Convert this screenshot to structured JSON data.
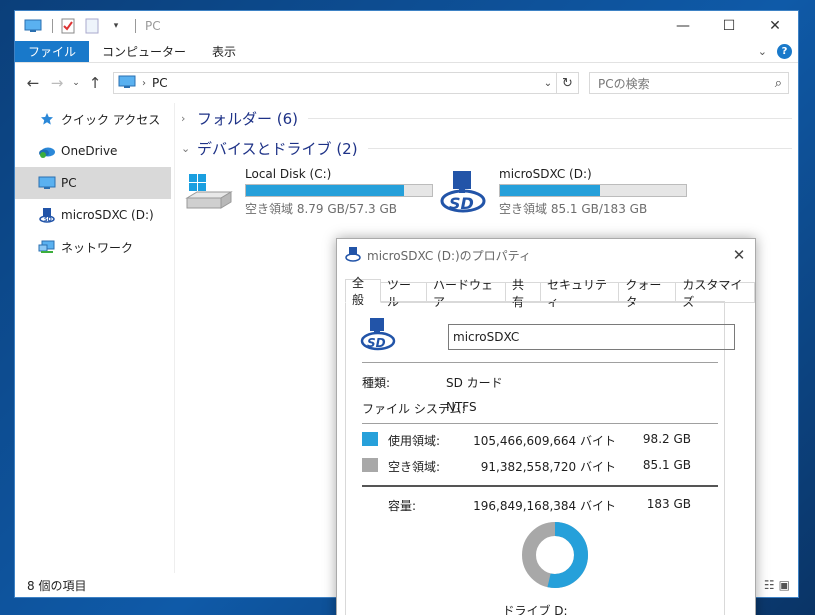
{
  "explorer": {
    "title": "PC",
    "ribbon_tabs": [
      "ファイル",
      "コンピューター",
      "表示"
    ],
    "address": {
      "crumb": "PC"
    },
    "search_placeholder": "PCの検索",
    "sidebar": [
      {
        "label": "クイック アクセス",
        "icon": "star-icon"
      },
      {
        "label": "OneDrive",
        "icon": "onedrive-icon"
      },
      {
        "label": "PC",
        "icon": "pc-icon",
        "selected": true
      },
      {
        "label": "microSDXC (D:)",
        "icon": "sd-card-icon"
      },
      {
        "label": "ネットワーク",
        "icon": "network-icon"
      }
    ],
    "groups": {
      "folders": "フォルダー (6)",
      "devices": "デバイスとドライブ (2)"
    },
    "drives": [
      {
        "name": "Local Disk (C:)",
        "free_text": "空き領域 8.79 GB/57.3 GB",
        "used_fraction": 0.847,
        "icon": "windows-drive-icon"
      },
      {
        "name": "microSDXC (D:)",
        "free_text": "空き領域 85.1 GB/183 GB",
        "used_fraction": 0.535,
        "icon": "sd-card-icon"
      }
    ],
    "status": "8 個の項目"
  },
  "dialog": {
    "title": "microSDXC (D:)のプロパティ",
    "tabs": [
      "全般",
      "ツール",
      "ハードウェア",
      "共有",
      "セキュリティ",
      "クォータ",
      "カスタマイズ"
    ],
    "volume_name": "microSDXC",
    "type_label": "種類:",
    "type_value": "SD カード",
    "fs_label": "ファイル システム:",
    "fs_value": "NTFS",
    "used_label": "使用領域:",
    "used_bytes": "105,466,609,664 バイト",
    "used_gb": "98.2 GB",
    "free_label": "空き領域:",
    "free_bytes": "91,382,558,720 バイト",
    "free_gb": "85.1 GB",
    "capacity_label": "容量:",
    "capacity_bytes": "196,849,168,384 バイト",
    "capacity_gb": "183 GB",
    "drive_label": "ドライブ D:",
    "used_color": "#26a0da",
    "free_color": "#a8a8a8",
    "used_fraction": 0.536
  }
}
